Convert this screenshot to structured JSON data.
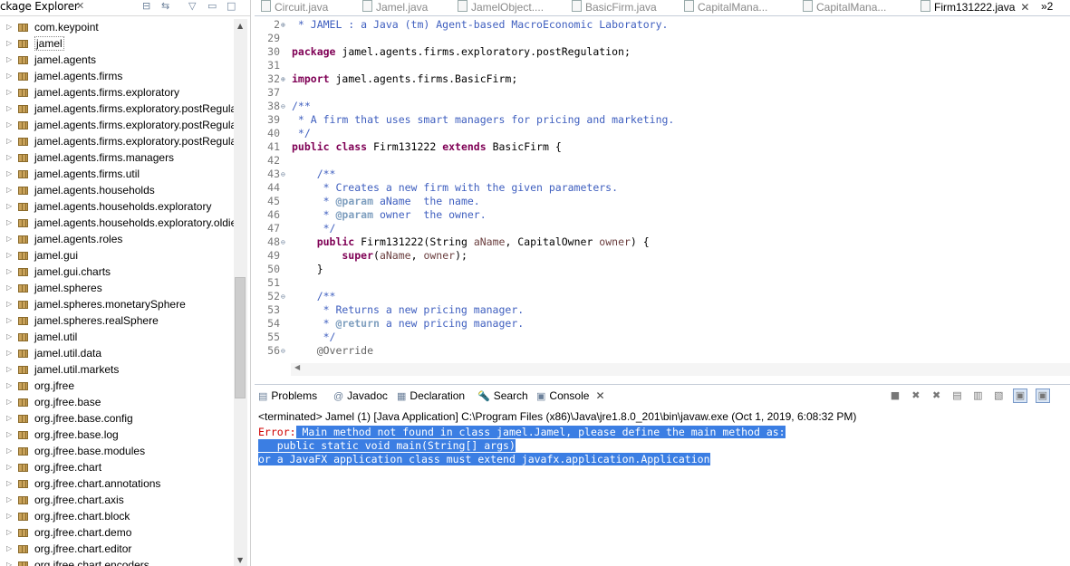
{
  "package_explorer": {
    "title": "ckage Explorer",
    "items": [
      "com.keypoint",
      "jamel",
      "jamel.agents",
      "jamel.agents.firms",
      "jamel.agents.firms.exploratory",
      "jamel.agents.firms.exploratory.postRegula",
      "jamel.agents.firms.exploratory.postRegula",
      "jamel.agents.firms.exploratory.postRegula",
      "jamel.agents.firms.managers",
      "jamel.agents.firms.util",
      "jamel.agents.households",
      "jamel.agents.households.exploratory",
      "jamel.agents.households.exploratory.oldie",
      "jamel.agents.roles",
      "jamel.gui",
      "jamel.gui.charts",
      "jamel.spheres",
      "jamel.spheres.monetarySphere",
      "jamel.spheres.realSphere",
      "jamel.util",
      "jamel.util.data",
      "jamel.util.markets",
      "org.jfree",
      "org.jfree.base",
      "org.jfree.base.config",
      "org.jfree.base.log",
      "org.jfree.base.modules",
      "org.jfree.chart",
      "org.jfree.chart.annotations",
      "org.jfree.chart.axis",
      "org.jfree.chart.block",
      "org.jfree.chart.demo",
      "org.jfree.chart.editor",
      "org.jfree.chart.encoders"
    ]
  },
  "editor": {
    "tabs": [
      "Circuit.java",
      "Jamel.java",
      "JamelObject....",
      "BasicFirm.java",
      "CapitalMana...",
      "CapitalMana...",
      "Firm131222.java"
    ],
    "overflow": "»2",
    "lines": {
      "l2": " * JAMEL : a Java (tm) Agent-based MacroEconomic Laboratory.",
      "l30_kw": "package",
      "l30_rest": " jamel.agents.firms.exploratory.postRegulation;",
      "l32_kw": "import",
      "l32_rest": " jamel.agents.firms.BasicFirm;",
      "l38": "/**",
      "l39": " * A firm that uses smart managers for pricing and marketing.",
      "l40": " */",
      "l41_kw1": "public class",
      "l41_mid": " Firm131222 ",
      "l41_kw2": "extends",
      "l41_rest": " BasicFirm {",
      "l43": "    /**",
      "l44": "     * Creates a new firm with the given parameters.",
      "l45_pre": "     * ",
      "l45_tag": "@param",
      "l45_rest": " aName  the name.",
      "l46_pre": "     * ",
      "l46_tag": "@param",
      "l46_rest": " owner  the owner.",
      "l47": "     */",
      "l48_kw": "    public",
      "l48_a": " Firm131222(String ",
      "l48_p1": "aName",
      "l48_b": ", CapitalOwner ",
      "l48_p2": "owner",
      "l48_c": ") {",
      "l49_kw": "        super",
      "l49_a": "(",
      "l49_p1": "aName",
      "l49_b": ", ",
      "l49_p2": "owner",
      "l49_c": ");",
      "l50": "    }",
      "l52": "    /**",
      "l53": "     * Returns a new pricing manager.",
      "l54_pre": "     * ",
      "l54_tag": "@return",
      "l54_rest": " a new pricing manager.",
      "l55": "     */",
      "l56": "    @Override"
    },
    "line_numbers": [
      "2",
      "29",
      "30",
      "31",
      "32",
      "37",
      "38",
      "39",
      "40",
      "41",
      "42",
      "43",
      "44",
      "45",
      "46",
      "47",
      "48",
      "49",
      "50",
      "51",
      "52",
      "53",
      "54",
      "55",
      "56"
    ]
  },
  "console": {
    "tabs": [
      "Problems",
      "Javadoc",
      "Declaration",
      "Search",
      "Console"
    ],
    "status": "<terminated> Jamel (1) [Java Application] C:\\Program Files (x86)\\Java\\jre1.8.0_201\\bin\\javaw.exe (Oct 1, 2019, 6:08:32 PM)",
    "error_prefix": "Error:",
    "line1": " Main method not found in class jamel.Jamel, please define the main method as:",
    "line2": "   public static void main(String[] args)",
    "line3": "or a JavaFX application class must extend javafx.application.Application"
  }
}
